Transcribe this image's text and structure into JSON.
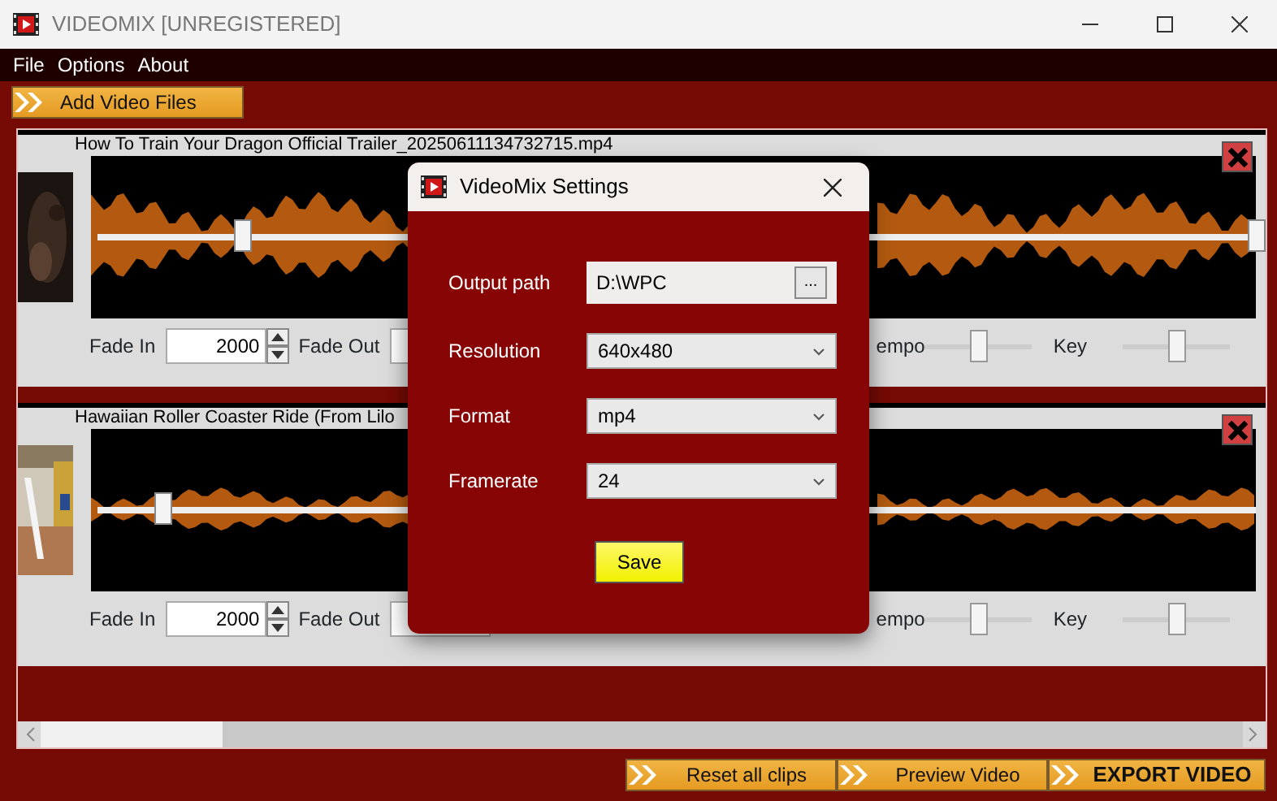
{
  "window": {
    "title": "VIDEOMIX  [UNREGISTERED]"
  },
  "menu": [
    "File",
    "Options",
    "About"
  ],
  "add_button": "Add Video Files",
  "clips": [
    {
      "title": "How To Train Your Dragon  Official Trailer_20250611134732715.mp4",
      "thumbnail": {
        "kind": "picture"
      },
      "markers": [
        {
          "level": 0.125
        },
        {
          "level": 1
        }
      ],
      "fade_in_label": "Fade In",
      "fade_in": "2000",
      "fade_out_label": "Fade Out",
      "tempo_label": "empo",
      "tempo": {
        "level": 0.5
      },
      "key_label": "Key",
      "key": {
        "level": 0.5
      }
    },
    {
      "title": "Hawaiian Roller Coaster Ride (From Lilo",
      "thumbnail": {
        "kind": "picture"
      },
      "markers": [
        {
          "level": 0.056
        }
      ],
      "fade_in_label": "Fade In",
      "fade_in": "2000",
      "fade_out_label": "Fade Out",
      "tempo_label": "empo",
      "tempo": {
        "level": 0.5
      },
      "key_label": "Key",
      "key": {
        "level": 0.5
      }
    }
  ],
  "footer_buttons": [
    {
      "label": "Reset all clips",
      "primary": false
    },
    {
      "label": "Preview Video",
      "primary": false
    },
    {
      "label": "EXPORT VIDEO",
      "primary": true
    }
  ],
  "dialog": {
    "title": "VideoMix Settings",
    "fields": [
      {
        "kind": "path",
        "label": "Output path",
        "value": "D:\\WPC",
        "button": "..."
      },
      {
        "kind": "select",
        "label": "Resolution",
        "value": "640x480"
      },
      {
        "kind": "select",
        "label": "Format",
        "value": "mp4"
      },
      {
        "kind": "select",
        "label": "Framerate",
        "value": "24"
      }
    ],
    "save": "Save"
  }
}
